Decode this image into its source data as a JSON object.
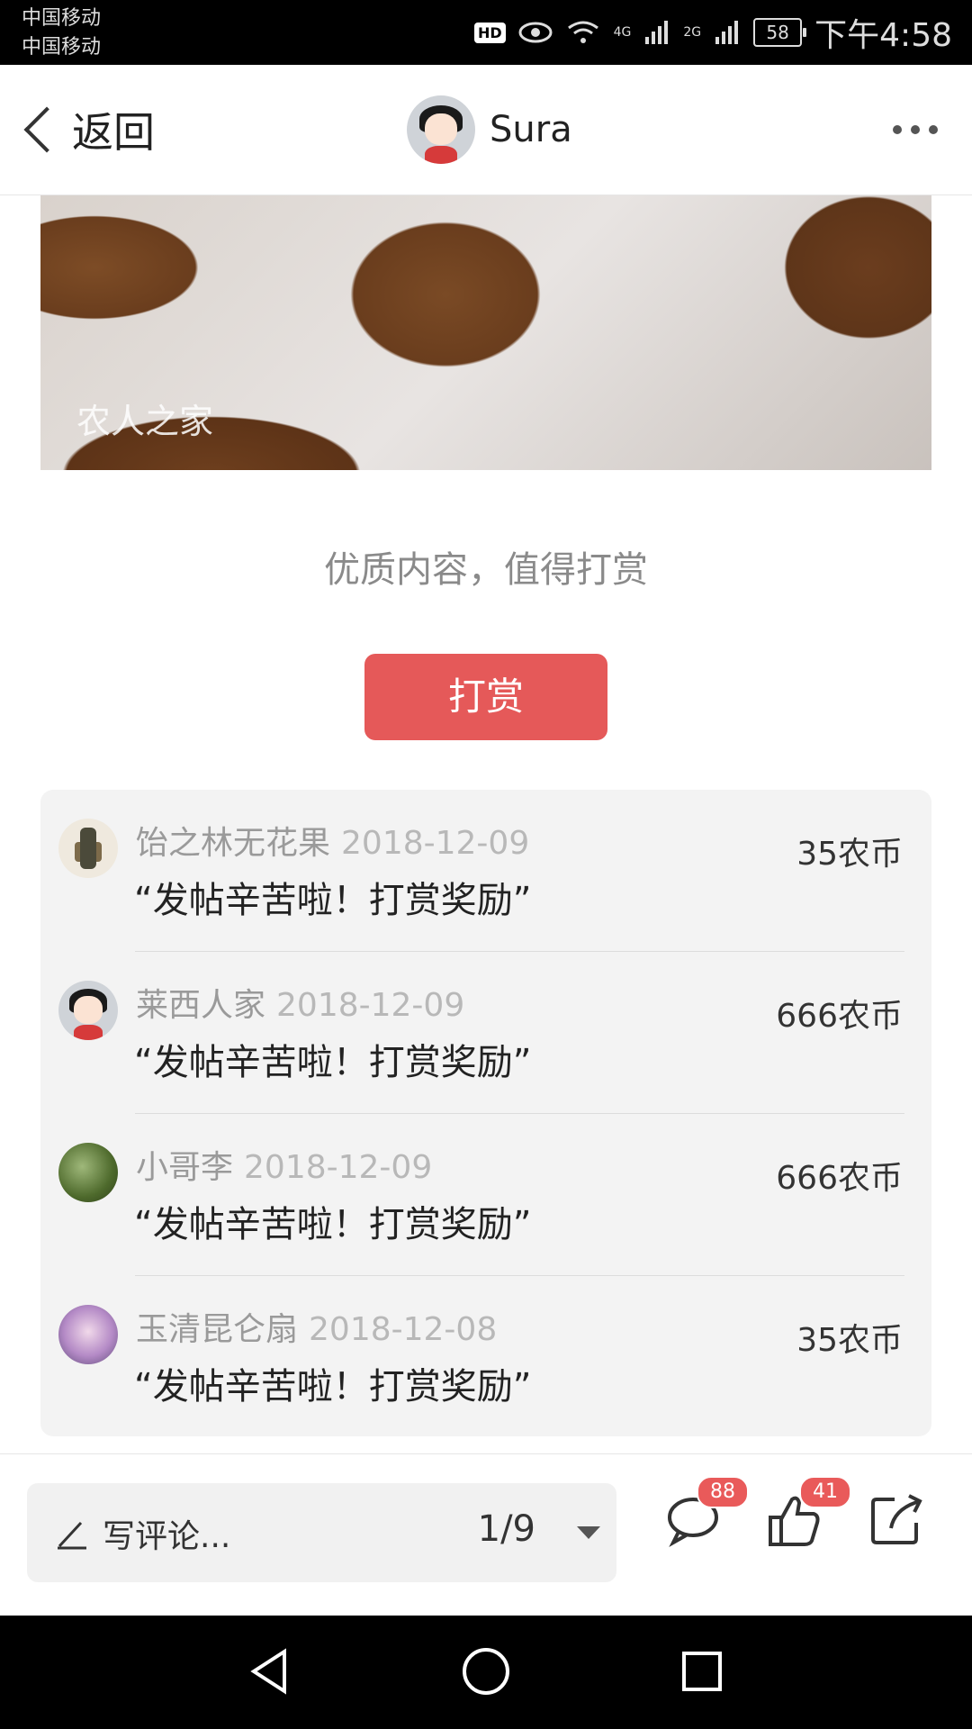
{
  "status_bar": {
    "carrier1": "中国移动",
    "carrier2": "中国移动",
    "hd": "HD",
    "net1": "4G",
    "net2": "2G",
    "battery": "58",
    "time": "下午4:58"
  },
  "nav": {
    "back_label": "返回",
    "username": "Sura"
  },
  "hero": {
    "watermark": "农人之家"
  },
  "reward": {
    "prompt": "优质内容，值得打赏",
    "button_label": "打赏"
  },
  "rewards": [
    {
      "name": "饴之林无花果",
      "date": "2018-12-09",
      "message": "“发帖辛苦啦！打赏奖励”",
      "amount": "35农币"
    },
    {
      "name": "莱西人家",
      "date": "2018-12-09",
      "message": "“发帖辛苦啦！打赏奖励”",
      "amount": "666农币"
    },
    {
      "name": "小哥李",
      "date": "2018-12-09",
      "message": "“发帖辛苦啦！打赏奖励”",
      "amount": "666农币"
    },
    {
      "name": "玉清昆仑扇",
      "date": "2018-12-08",
      "message": "“发帖辛苦啦！打赏奖励”",
      "amount": "35农币"
    }
  ],
  "bottom_bar": {
    "comment_placeholder": "写评论...",
    "page_indicator": "1/9",
    "comment_count": "88",
    "like_count": "41"
  },
  "colors": {
    "accent": "#e55959",
    "badge": "#e95a5a"
  }
}
